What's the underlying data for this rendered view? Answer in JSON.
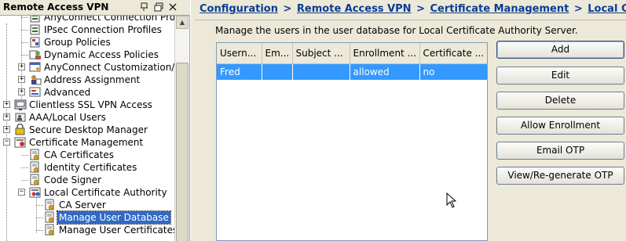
{
  "left_panel": {
    "title": "Remote Access VPN",
    "icons": [
      "pin-icon",
      "float-icon",
      "close-icon"
    ]
  },
  "tree": [
    {
      "label": "AnyConnect Connection Prof",
      "icon": "connection-profile-icon",
      "level": 2,
      "expander": "none"
    },
    {
      "label": "IPsec Connection Profiles",
      "icon": "ipsec-profile-icon",
      "level": 2,
      "expander": "none"
    },
    {
      "label": "Group Policies",
      "icon": "group-policy-icon",
      "level": 2,
      "expander": "none"
    },
    {
      "label": "Dynamic Access Policies",
      "icon": "dynamic-access-icon",
      "level": 2,
      "expander": "none"
    },
    {
      "label": "AnyConnect Customization/L",
      "icon": "customization-icon",
      "level": 2,
      "expander": "plus"
    },
    {
      "label": "Address Assignment",
      "icon": "address-assignment-icon",
      "level": 2,
      "expander": "plus"
    },
    {
      "label": "Advanced",
      "icon": "advanced-icon",
      "level": 2,
      "expander": "plus"
    },
    {
      "label": "Clientless SSL VPN Access",
      "icon": "clientless-icon",
      "level": 1,
      "expander": "plus"
    },
    {
      "label": "AAA/Local Users",
      "icon": "aaa-users-icon",
      "level": 1,
      "expander": "plus"
    },
    {
      "label": "Secure Desktop Manager",
      "icon": "secure-desktop-icon",
      "level": 1,
      "expander": "plus"
    },
    {
      "label": "Certificate Management",
      "icon": "certificate-folder-icon",
      "level": 1,
      "expander": "minus"
    },
    {
      "label": "CA Certificates",
      "icon": "certificate-icon",
      "level": 2,
      "expander": "none"
    },
    {
      "label": "Identity Certificates",
      "icon": "certificate-icon",
      "level": 2,
      "expander": "none"
    },
    {
      "label": "Code Signer",
      "icon": "certificate-icon",
      "level": 2,
      "expander": "none"
    },
    {
      "label": "Local Certificate Authority",
      "icon": "certificate-authority-icon",
      "level": 2,
      "expander": "minus"
    },
    {
      "label": "CA Server",
      "icon": "certificate-icon",
      "level": 3,
      "expander": "none"
    },
    {
      "label": "Manage User Database",
      "icon": "certificate-icon",
      "level": 3,
      "expander": "none",
      "selected": true
    },
    {
      "label": "Manage User Certificates",
      "icon": "certificate-icon",
      "level": 3,
      "expander": "none"
    }
  ],
  "breadcrumb": [
    "Configuration",
    "Remote Access VPN",
    "Certificate Management",
    "Local Certificate"
  ],
  "breadcrumb_separator": ">",
  "description": "Manage the users in the user database for Local Certificate Authority Server.",
  "table": {
    "columns": [
      "Usern...",
      "Em...",
      "Subject ...",
      "Enrollment ...",
      "Certificate ..."
    ],
    "rows": [
      [
        "Fred",
        "",
        "",
        "allowed",
        "no"
      ]
    ]
  },
  "buttons": [
    "Add",
    "Edit",
    "Delete",
    "Allow Enrollment",
    "Email OTP",
    "View/Re-generate OTP"
  ],
  "colors": {
    "selection": "#316ac5",
    "row_selection": "#3399ff",
    "breadcrumb": "#0a3d91",
    "background": "#ece9d8"
  }
}
